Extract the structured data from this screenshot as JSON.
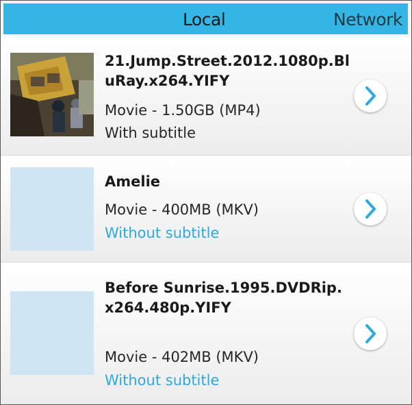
{
  "tabs": {
    "local": "Local",
    "network": "Network"
  },
  "videos": [
    {
      "title": "21.Jump.Street.2012.1080p.BluRay.x264.YIFY",
      "meta": "Movie - 1.50GB (MP4)",
      "subtitle": "With subtitle",
      "thumbnail": "movie-frame-bus-scene"
    },
    {
      "title": "Amelie",
      "meta": "Movie - 400MB (MKV)",
      "subtitle": "Without subtitle",
      "thumbnail": "placeholder"
    },
    {
      "title": "Before Sunrise.1995.DVDRip.x264.480p.YIFY",
      "meta": "Movie - 402MB (MKV)",
      "subtitle": "Without subtitle",
      "thumbnail": "placeholder"
    }
  ],
  "colors": {
    "accent": "#33b5e5",
    "without_subtitle": "#2fa9dc",
    "placeholder_thumb": "#cfe5f3"
  }
}
